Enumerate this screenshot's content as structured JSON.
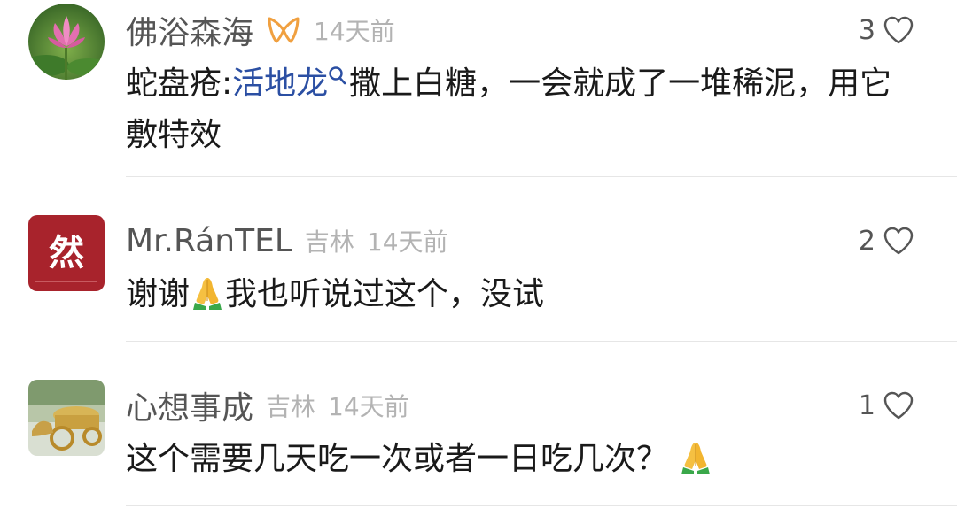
{
  "comments": [
    {
      "username": "佛浴森海",
      "badge_icon": "ribbon-badge-icon",
      "location": "",
      "time": "14天前",
      "likes": "3",
      "text_before_link": "蛇盘疮:",
      "link_text": "活地龙",
      "text_after_link": "撒上白糖，一会就成了一堆稀泥，用它敷特效",
      "avatar": "lotus-flower-photo"
    },
    {
      "username": "Mr.RánTEL",
      "location": "吉林",
      "time": "14天前",
      "likes": "2",
      "text_before_emoji": "谢谢",
      "emoji": "praying-hands",
      "text_after_emoji": "我也听说过这个，没试",
      "avatar": "red-calligraphy-avatar",
      "avatar_glyph": "然"
    },
    {
      "username": "心想事成",
      "location": "吉林",
      "time": "14天前",
      "likes": "1",
      "text_before_emoji": "这个需要几天吃一次或者一日吃几次？",
      "emoji": "praying-hands",
      "avatar": "golden-cart-photo"
    }
  ],
  "colors": {
    "username": "#555555",
    "meta": "#b3b3b3",
    "link": "#2b4fa3",
    "badge": "#f0a040"
  }
}
